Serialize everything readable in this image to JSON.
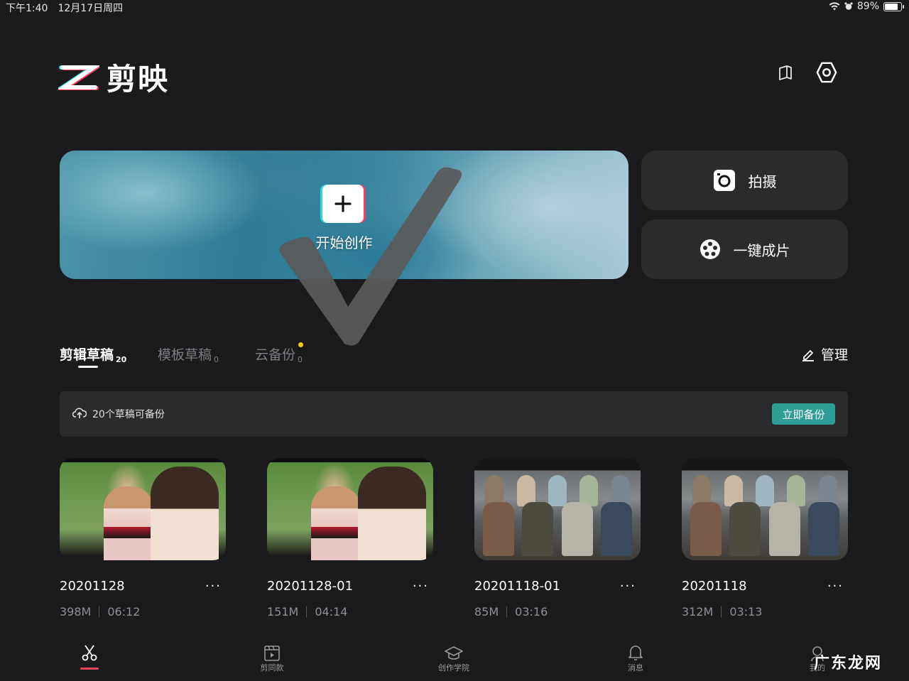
{
  "status_bar": {
    "time": "下午1:40",
    "date": "12月17日周四",
    "battery": "89%",
    "battery_level": 0.89
  },
  "header": {
    "app_name": "剪映",
    "icons": [
      "tutorial-book-icon",
      "settings-hexagon-icon"
    ]
  },
  "create": {
    "start_label": "开始创作",
    "shoot_label": "拍摄",
    "one_click_label": "一键成片"
  },
  "tabs": [
    {
      "label": "剪辑草稿",
      "count": "20",
      "active": true
    },
    {
      "label": "模板草稿",
      "count": "0",
      "active": false
    },
    {
      "label": "云备份",
      "count": "0",
      "active": false,
      "badge": true
    }
  ],
  "manage_label": "管理",
  "backup": {
    "message": "20个草稿可备份",
    "button": "立即备份"
  },
  "drafts": [
    {
      "title": "20201128",
      "size": "398M",
      "duration": "06:12"
    },
    {
      "title": "20201128-01",
      "size": "151M",
      "duration": "04:14"
    },
    {
      "title": "20201118-01",
      "size": "85M",
      "duration": "03:16"
    },
    {
      "title": "20201118",
      "size": "312M",
      "duration": "03:13"
    }
  ],
  "more_label": "···",
  "nav": [
    {
      "label": "",
      "icon": "scissors-icon",
      "active": true
    },
    {
      "label": "剪同款",
      "icon": "template-video-icon"
    },
    {
      "label": "创作学院",
      "icon": "graduation-cap-icon"
    },
    {
      "label": "消息",
      "icon": "bell-icon"
    },
    {
      "label": "我的",
      "icon": "profile-icon"
    }
  ],
  "watermark": "广东龙网",
  "colors": {
    "background": "#1b1b1d",
    "panel": "#2a2b2d",
    "accent_teal": "#2e9e96",
    "accent_red": "#e8455b",
    "badge_yellow": "#f5c61b"
  }
}
